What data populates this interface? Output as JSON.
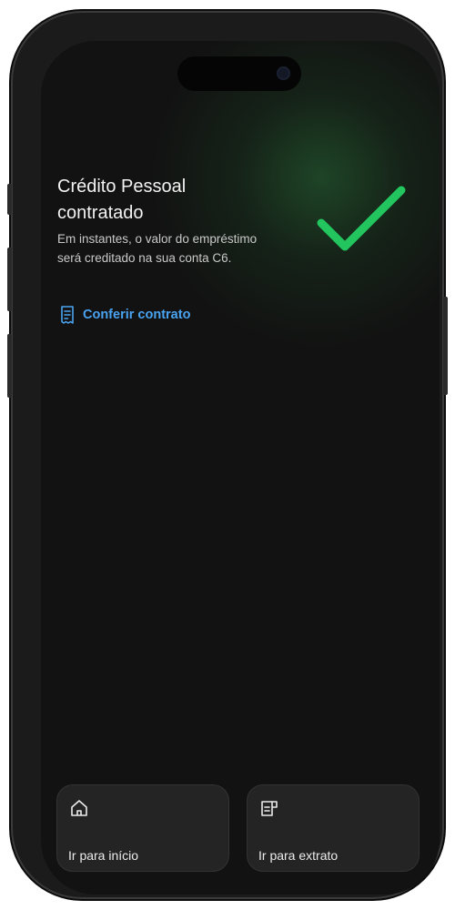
{
  "success": {
    "title": "Crédito Pessoal\ncontratado",
    "message": "Em instantes, o valor do empréstimo\nserá creditado na sua conta C6.",
    "check_color": "#22c55e"
  },
  "contract_link": {
    "label": "Conferir contrato",
    "icon": "receipt-icon",
    "color": "#4aa3f0"
  },
  "actions": [
    {
      "label": "Ir para início",
      "icon": "home-icon"
    },
    {
      "label": "Ir para extrato",
      "icon": "statement-icon"
    }
  ],
  "theme": {
    "background": "#121212",
    "card": "#242424"
  }
}
